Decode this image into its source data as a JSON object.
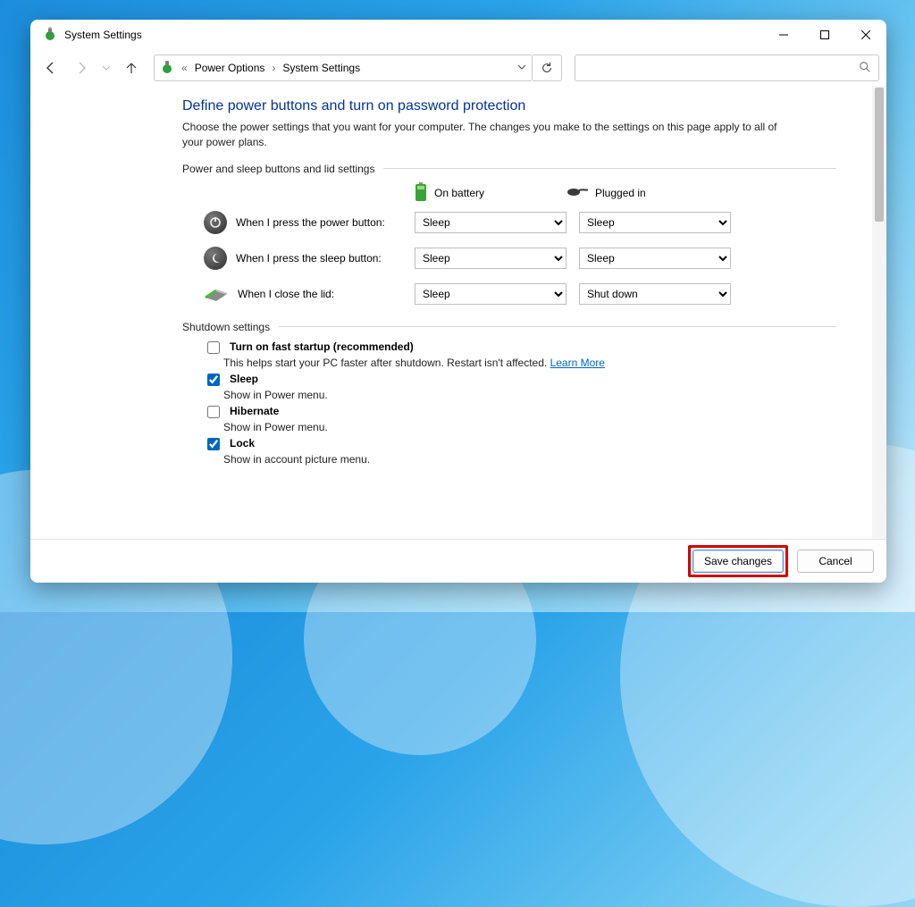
{
  "window": {
    "title": "System Settings"
  },
  "breadcrumb": {
    "item1": "Power Options",
    "item2": "System Settings"
  },
  "page": {
    "heading": "Define power buttons and turn on password protection",
    "intro": "Choose the power settings that you want for your computer. The changes you make to the settings on this page apply to all of your power plans.",
    "section_power": "Power and sleep buttons and lid settings",
    "section_shutdown": "Shutdown settings",
    "col_battery": "On battery",
    "col_plugged": "Plugged in",
    "row_power": "When I press the power button:",
    "row_sleep": "When I press the sleep button:",
    "row_lid": "When I close the lid:"
  },
  "selects": {
    "power_battery": "Sleep",
    "power_plugged": "Sleep",
    "sleep_battery": "Sleep",
    "sleep_plugged": "Sleep",
    "lid_battery": "Sleep",
    "lid_plugged": "Shut down"
  },
  "shutdown": {
    "fast_label": "Turn on fast startup (recommended)",
    "fast_desc": "This helps start your PC faster after shutdown. Restart isn't affected. ",
    "learn_more": "Learn More",
    "sleep_label": "Sleep",
    "sleep_desc": "Show in Power menu.",
    "hibernate_label": "Hibernate",
    "hibernate_desc": "Show in Power menu.",
    "lock_label": "Lock",
    "lock_desc": "Show in account picture menu."
  },
  "footer": {
    "save": "Save changes",
    "cancel": "Cancel"
  }
}
